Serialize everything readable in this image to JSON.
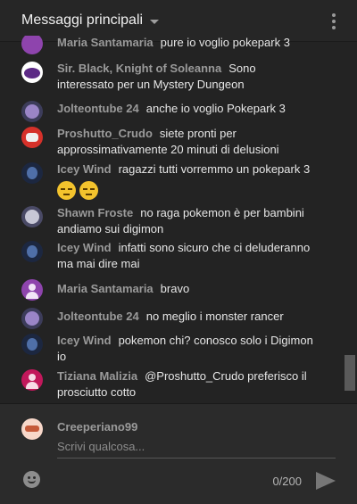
{
  "header": {
    "title": "Messaggi principali",
    "dropdown_icon": "triangle-down-icon",
    "menu_icon": "more-vert-icon"
  },
  "messages": [
    {
      "author": "Maria Santamaria",
      "text": "pure io voglio pokepark 3",
      "avatar_color": "#8e44ad"
    },
    {
      "author": "Sir. Black, Knight of Soleanna",
      "text": "Sono interessato per un Mystery Dungeon",
      "avatar_color": "#6a2c9a"
    },
    {
      "author": "Jolteontube 24",
      "text": "anche io voglio Pokepark 3",
      "avatar_color": "#3c3c5a"
    },
    {
      "author": "Proshutto_Crudo",
      "text": "siete pronti per approssimativamente 20 minuti di delusioni",
      "avatar_color": "#d6312a"
    },
    {
      "author": "Icey Wind",
      "text": "ragazzi tutti vorremmo un pokepark 3",
      "avatar_color": "#1c2740",
      "emojis": 2
    },
    {
      "author": "Shawn Froste",
      "text": "no raga pokemon è per bambini andiamo sui digimon",
      "avatar_color": "#4a4a66"
    },
    {
      "author": "Icey Wind",
      "text": "infatti sono sicuro che ci deluderanno ma mai dire mai",
      "avatar_color": "#1c2740"
    },
    {
      "author": "Maria Santamaria",
      "text": "bravo",
      "avatar_color": "#8e44ad"
    },
    {
      "author": "Jolteontube 24",
      "text": "no meglio i monster rancer",
      "avatar_color": "#3c3c5a"
    },
    {
      "author": "Icey Wind",
      "text": "pokemon chi? conosco solo i Digimon io",
      "avatar_color": "#1c2740"
    },
    {
      "author": "Tiziana Malizia",
      "text": "@Proshutto_Crudo preferisco il prosciutto cotto",
      "avatar_color": "#c2185b"
    }
  ],
  "composer": {
    "author": "Creeperiano99",
    "placeholder": "Scrivi qualcosa...",
    "counter": "0/200",
    "emoji_icon": "emoji-icon",
    "send_icon": "send-icon"
  }
}
